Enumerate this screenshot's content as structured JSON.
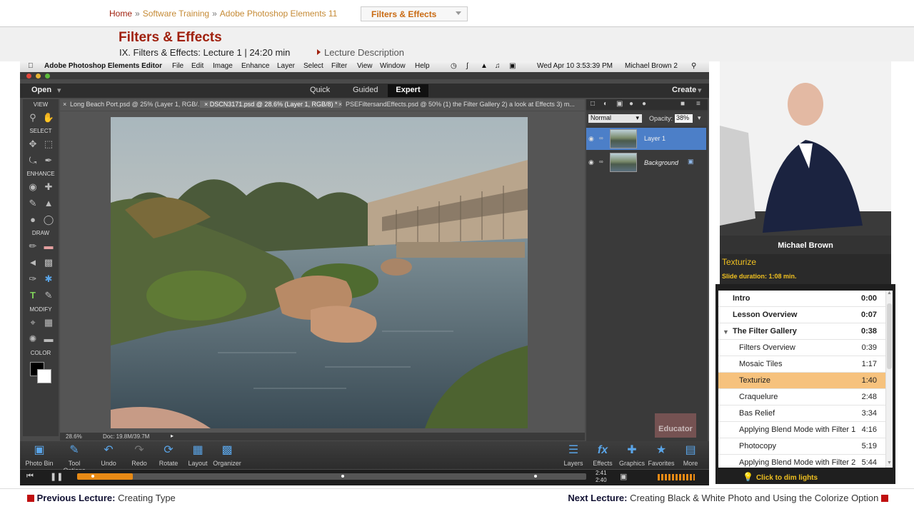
{
  "breadcrumb": {
    "home": "Home",
    "software": "Software Training",
    "course": "Adobe Photoshop Elements 11",
    "current": "Filters & Effects"
  },
  "lecture": {
    "title": "Filters & Effects",
    "subtitle": "IX. Filters & Effects: Lecture 1 | 24:20 min",
    "description_link": "Lecture Description"
  },
  "video": {
    "menubar": {
      "app": "Adobe Photoshop Elements Editor",
      "items": [
        "File",
        "Edit",
        "Image",
        "Enhance",
        "Layer",
        "Select",
        "Filter",
        "View",
        "Window",
        "Help"
      ],
      "clock": "Wed Apr 10  3:53:39 PM",
      "user": "Michael Brown 2"
    },
    "modes": {
      "open": "Open",
      "quick": "Quick",
      "guided": "Guided",
      "expert": "Expert",
      "create": "Create"
    },
    "tabs": [
      "Long Beach Port.psd @ 25% (Layer 1, RGB/...",
      "DSCN3171.psd @ 28.6% (Layer 1, RGB/8) *",
      "PSEFiltersandEffects.psd @ 50% (1) the Filter Gallery 2) a look at Effects 3) m..."
    ],
    "tool_sections": [
      "VIEW",
      "SELECT",
      "ENHANCE",
      "DRAW",
      "MODIFY",
      "COLOR"
    ],
    "status": {
      "zoom": "28.6%",
      "doc": "Doc: 19.8M/39.7M"
    },
    "layers": {
      "blend_mode": "Normal",
      "opacity_label": "Opacity:",
      "opacity": "38%",
      "items": [
        "Layer 1",
        "Background"
      ]
    },
    "taskbar_left": [
      "Photo Bin",
      "Tool Options",
      "Undo",
      "Redo",
      "Rotate",
      "Layout",
      "Organizer"
    ],
    "taskbar_right": [
      "Layers",
      "Effects",
      "Graphics",
      "Favorites",
      "More"
    ],
    "watermark": "Educator"
  },
  "player": {
    "elapsed": "2:41",
    "total": "2:40",
    "progress": 0.11
  },
  "instructor": {
    "name": "Michael Brown"
  },
  "slide": {
    "title": "Texturize",
    "duration": "Slide duration: 1:08 min."
  },
  "toc": [
    {
      "name": "Intro",
      "time": "0:00",
      "bold": true,
      "indent": 0
    },
    {
      "name": "Lesson Overview",
      "time": "0:07",
      "bold": true,
      "indent": 0
    },
    {
      "name": "The Filter Gallery",
      "time": "0:38",
      "bold": true,
      "indent": 0,
      "expanded": true
    },
    {
      "name": "Filters Overview",
      "time": "0:39",
      "bold": false,
      "indent": 1
    },
    {
      "name": "Mosaic Tiles",
      "time": "1:17",
      "bold": false,
      "indent": 1
    },
    {
      "name": "Texturize",
      "time": "1:40",
      "bold": false,
      "indent": 1,
      "selected": true
    },
    {
      "name": "Craquelure",
      "time": "2:48",
      "bold": false,
      "indent": 1
    },
    {
      "name": "Bas Relief",
      "time": "3:34",
      "bold": false,
      "indent": 1
    },
    {
      "name": "Applying Blend Mode with Filter 1",
      "time": "4:16",
      "bold": false,
      "indent": 1
    },
    {
      "name": "Photocopy",
      "time": "5:19",
      "bold": false,
      "indent": 1
    },
    {
      "name": "Applying Blend Mode with Filter 2",
      "time": "5:44",
      "bold": false,
      "indent": 1
    }
  ],
  "dim_lights": "Click to dim lights",
  "footer": {
    "prev_label": "Previous Lecture:",
    "prev_title": "Creating Type",
    "next_label": "Next Lecture:",
    "next_title": "Creating Black & White Photo and Using the Colorize Option"
  },
  "colors": {
    "accent_red": "#a0210e",
    "accent_orange": "#e88a15",
    "toc_selected": "#f6c27d",
    "slide_yellow": "#f0c020"
  }
}
